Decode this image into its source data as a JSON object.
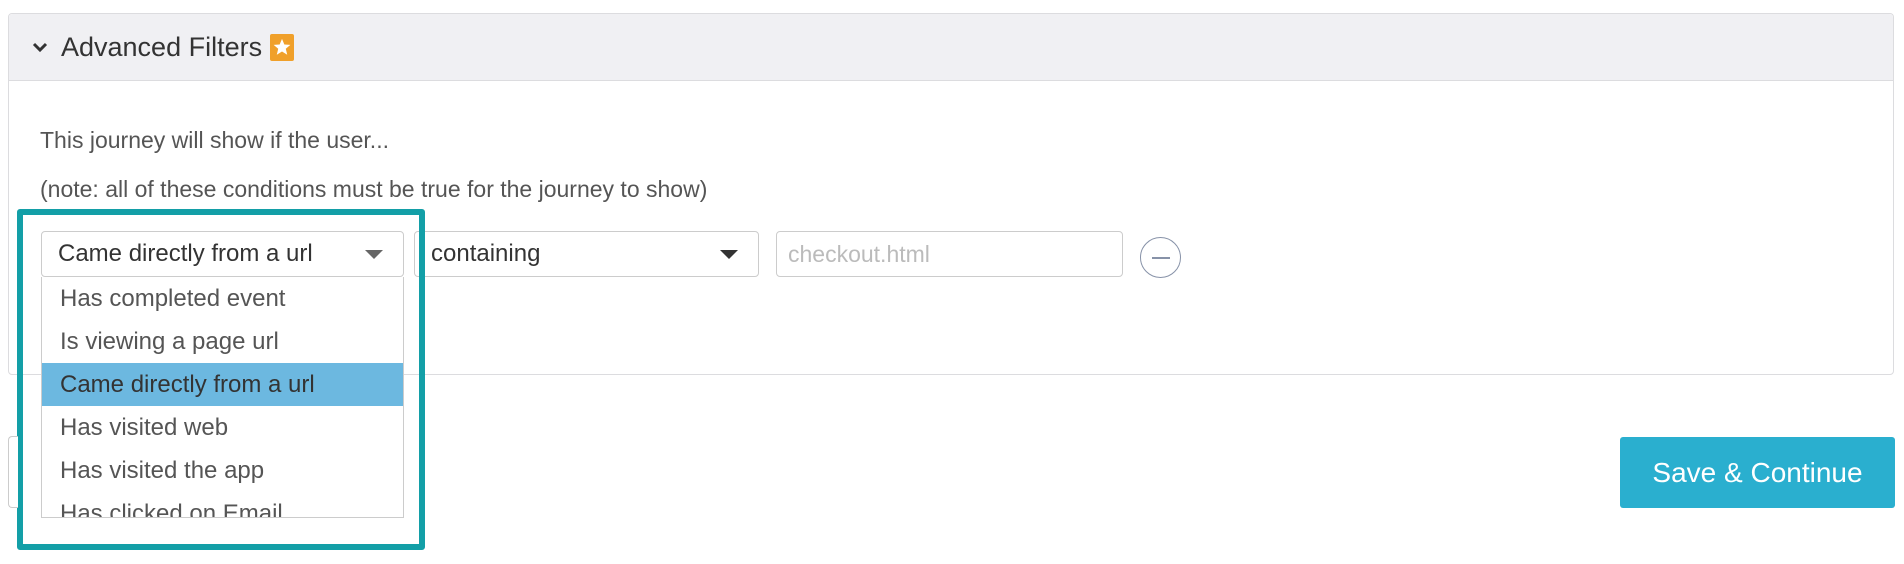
{
  "panel": {
    "title": "Advanced Filters",
    "expand_icon": "chevron-down-icon",
    "badge_icon": "star-icon",
    "badge_color": "#f0a02a"
  },
  "description": {
    "intro": "This journey will show if the user...",
    "note": "(note: all of these conditions must be true for the journey to show)"
  },
  "filter": {
    "condition_value": "Came directly from a url",
    "operator_value": "containing",
    "url_placeholder": "checkout.html",
    "remove_icon": "minus-circle-icon"
  },
  "dropdown": {
    "items": [
      {
        "label": "Has completed event"
      },
      {
        "label": "Is viewing a page url"
      },
      {
        "label": "Came directly from a url",
        "selected": true
      },
      {
        "label": "Has visited web"
      },
      {
        "label": "Has visited the app"
      },
      {
        "label": "Has clicked on Email"
      }
    ],
    "highlight_color": "#6cb8e0"
  },
  "annotation": {
    "highlight_color": "#139fa7"
  },
  "actions": {
    "save_label": "Save & Continue",
    "save_color": "#2aafcf"
  }
}
